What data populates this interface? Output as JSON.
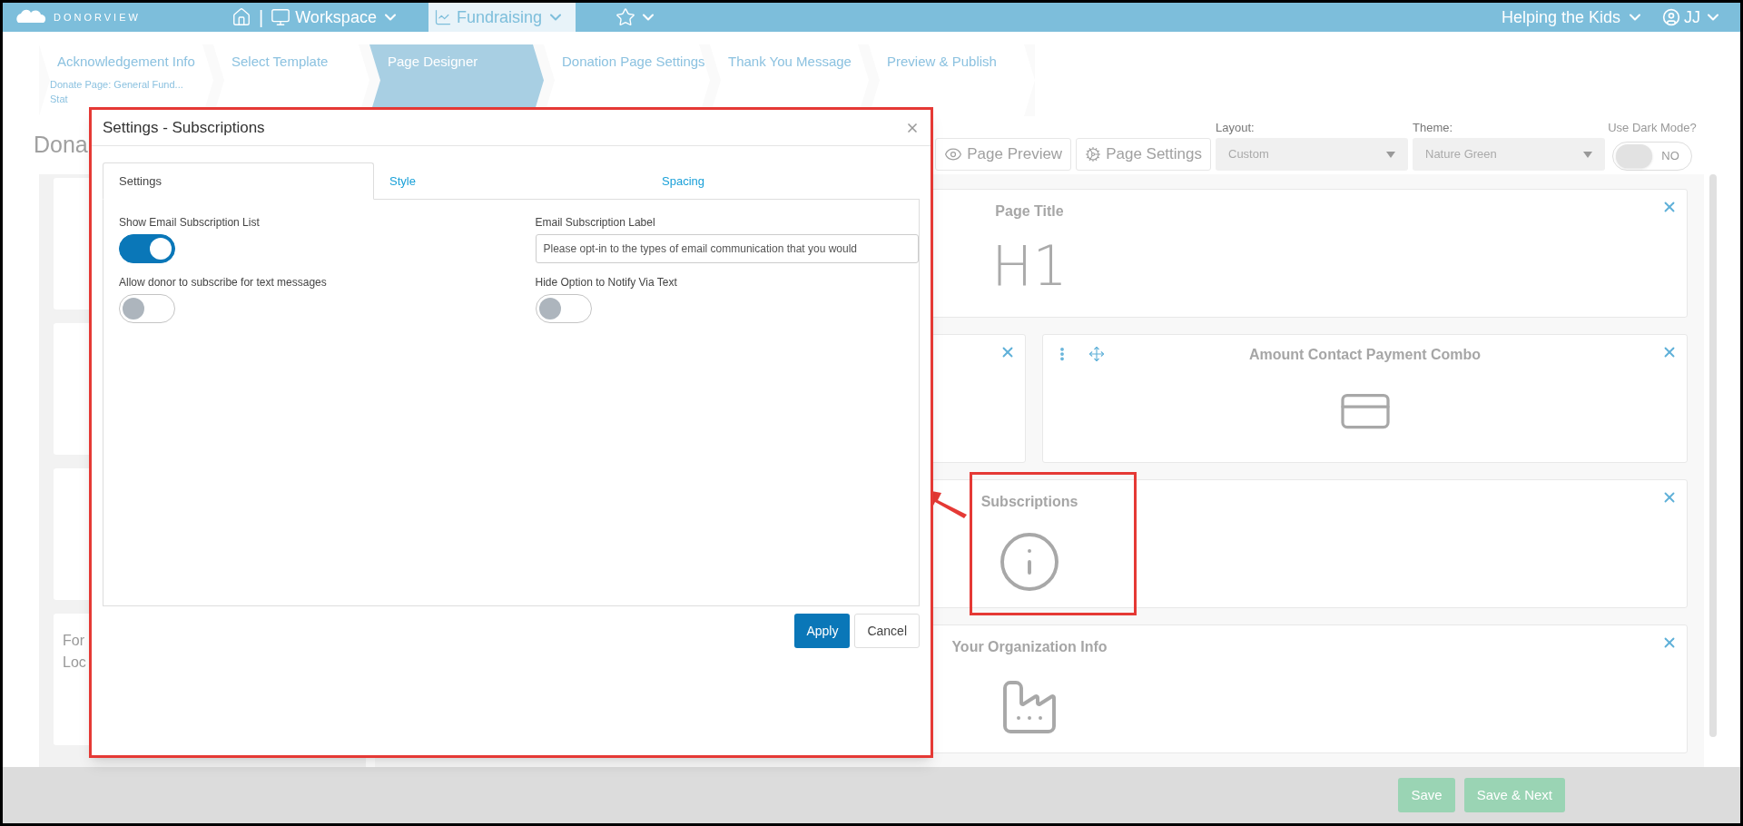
{
  "top_nav": {
    "brand": "DONORVIEW",
    "separator": "|",
    "workspace": "Workspace",
    "fundraising": "Fundraising",
    "org": "Helping the Kids",
    "user": "JJ"
  },
  "wizard": {
    "steps": [
      {
        "label": "Acknowledgement Info",
        "selected": false
      },
      {
        "label": "Select Template",
        "selected": false
      },
      {
        "label": "Page Designer",
        "selected": true
      },
      {
        "label": "Donation Page Settings",
        "selected": false
      },
      {
        "label": "Thank You Message",
        "selected": false
      },
      {
        "label": "Preview & Publish",
        "selected": false
      }
    ],
    "subtitle": "Donate Page: General Fund...",
    "status": "Stat"
  },
  "page_heading": "Dona",
  "left_panel": {
    "card_lines": [
      "For",
      "Loc"
    ]
  },
  "toolbar": {
    "preview": "Page Preview",
    "settings": "Page Settings",
    "layout_label": "Layout:",
    "layout_value": "Custom",
    "theme_label": "Theme:",
    "theme_value": "Nature Green",
    "dark_label": "Use Dark Mode?",
    "dark_on": false,
    "dark_text": "NO"
  },
  "cards": [
    {
      "kind": "heading",
      "title": "Page Title",
      "glyph": "H1"
    },
    {
      "kind": "row",
      "items": [
        {
          "kind": "blank"
        },
        {
          "kind": "payment",
          "title": "Amount Contact Payment Combo"
        }
      ]
    },
    {
      "kind": "info",
      "title": "Subscriptions",
      "highlighted": true
    },
    {
      "kind": "factory",
      "title": "Your Organization Info"
    }
  ],
  "modal": {
    "title": "Settings - Subscriptions",
    "tabs": [
      {
        "label": "Settings",
        "selected": true
      },
      {
        "label": "Style",
        "selected": false
      },
      {
        "label": "Spacing",
        "selected": false
      }
    ],
    "toggles": [
      {
        "label": "Show Email Subscription List",
        "on": true
      },
      {
        "label": "Allow donor to subscribe for text messages",
        "on": false
      },
      {
        "label": "Hide Option to Notify Via Text",
        "on": false
      }
    ],
    "field": {
      "label": "Email Subscription Label",
      "value": "Please opt-in to the types of email communication that you would"
    },
    "apply": "Apply",
    "cancel": "Cancel"
  },
  "footer": {
    "buttons": [
      {
        "label": "Save",
        "disabled": true
      },
      {
        "label": "Save & Next",
        "disabled": true
      }
    ]
  }
}
